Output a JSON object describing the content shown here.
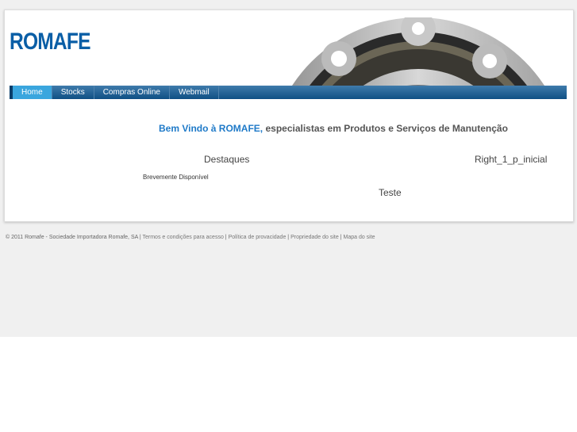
{
  "header": {
    "logo": "ROMAFE"
  },
  "nav": {
    "items": [
      {
        "label": "Home",
        "active": true
      },
      {
        "label": "Stocks"
      },
      {
        "label": "Compras Online"
      },
      {
        "label": "Webmail"
      }
    ]
  },
  "main": {
    "welcome_highlight": "Bem Vindo à ROMAFE,",
    "welcome_rest": " especialistas em Produtos e Serviços de Manutenção",
    "destaques": "Destaques",
    "brevemente": "Brevemente Disponível",
    "right_title": "Right_1_p_inicial",
    "teste": "Teste"
  },
  "footer": {
    "copyright": "© 2011 Romafe - Sociedade Importadora Romafe, SA",
    "sep": " | ",
    "links": [
      "Termos e condições para acesso",
      "Política de provacidade",
      "Propriedade do site",
      "Mapa do site"
    ]
  }
}
